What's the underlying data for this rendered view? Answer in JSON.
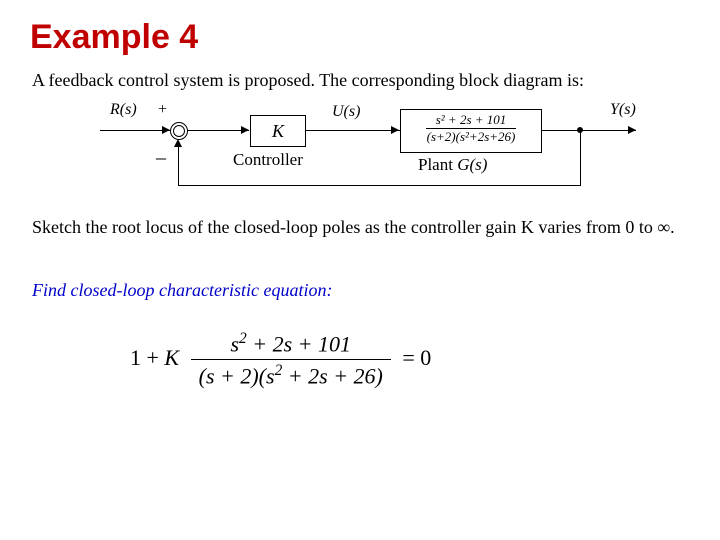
{
  "title": "Example 4",
  "intro": "A feedback control system is proposed.  The corresponding block diagram is:",
  "diagram": {
    "r_label": "R(s)",
    "plus": "+",
    "minus": "_",
    "controller_box": "K",
    "controller_label": "Controller",
    "u_label": "U(s)",
    "plant_num": "s² + 2s + 101",
    "plant_den": "(s+2)(s²+2s+26)",
    "plant_label_pre": "Plant  ",
    "plant_label_g": "G(s)",
    "y_label": "Y(s)"
  },
  "sketch_text": "Sketch the root locus of the closed-loop poles as the controller gain K varies from 0 to ∞.",
  "find_text": "Find closed-loop characteristic equation:",
  "equation": {
    "lead": "1 + K",
    "num": "s² + 2s + 101",
    "den": "(s + 2)(s² + 2s + 26)",
    "tail": "= 0"
  }
}
